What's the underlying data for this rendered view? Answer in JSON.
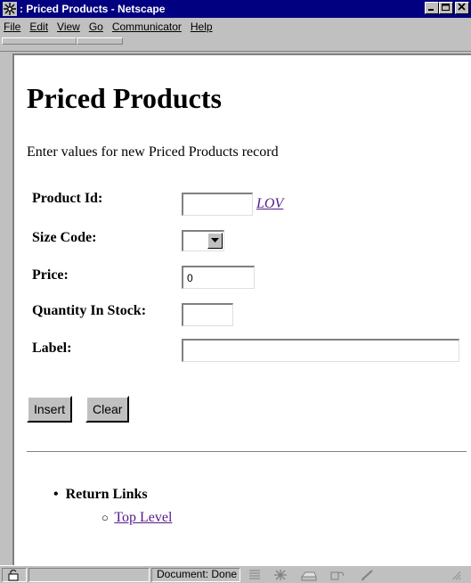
{
  "window": {
    "title": ": Priced Products - Netscape",
    "minimize": "_",
    "maximize": "□",
    "close": "✕"
  },
  "menu": [
    "File",
    "Edit",
    "View",
    "Go",
    "Communicator",
    "Help"
  ],
  "page": {
    "heading": "Priced Products",
    "intro": "Enter values for new Priced Products record",
    "fields": {
      "product_id": {
        "label": "Product Id:",
        "value": ""
      },
      "size_code": {
        "label": "Size Code:",
        "value": ""
      },
      "price": {
        "label": "Price:",
        "value": "0"
      },
      "quantity": {
        "label": "Quantity In Stock:",
        "value": ""
      },
      "label": {
        "label": "Label:",
        "value": ""
      }
    },
    "lov_link": "LOV",
    "buttons": {
      "insert": "Insert",
      "clear": "Clear"
    },
    "return_links": {
      "heading": "Return Links",
      "items": [
        "Top Level"
      ]
    }
  },
  "status": {
    "text": "Document: Done"
  },
  "icons": [
    "netscape-logo-icon",
    "security-lock-icon",
    "dropdown-arrow-icon",
    "network-icon",
    "mail-icon",
    "composer-icon",
    "edit-icon"
  ]
}
